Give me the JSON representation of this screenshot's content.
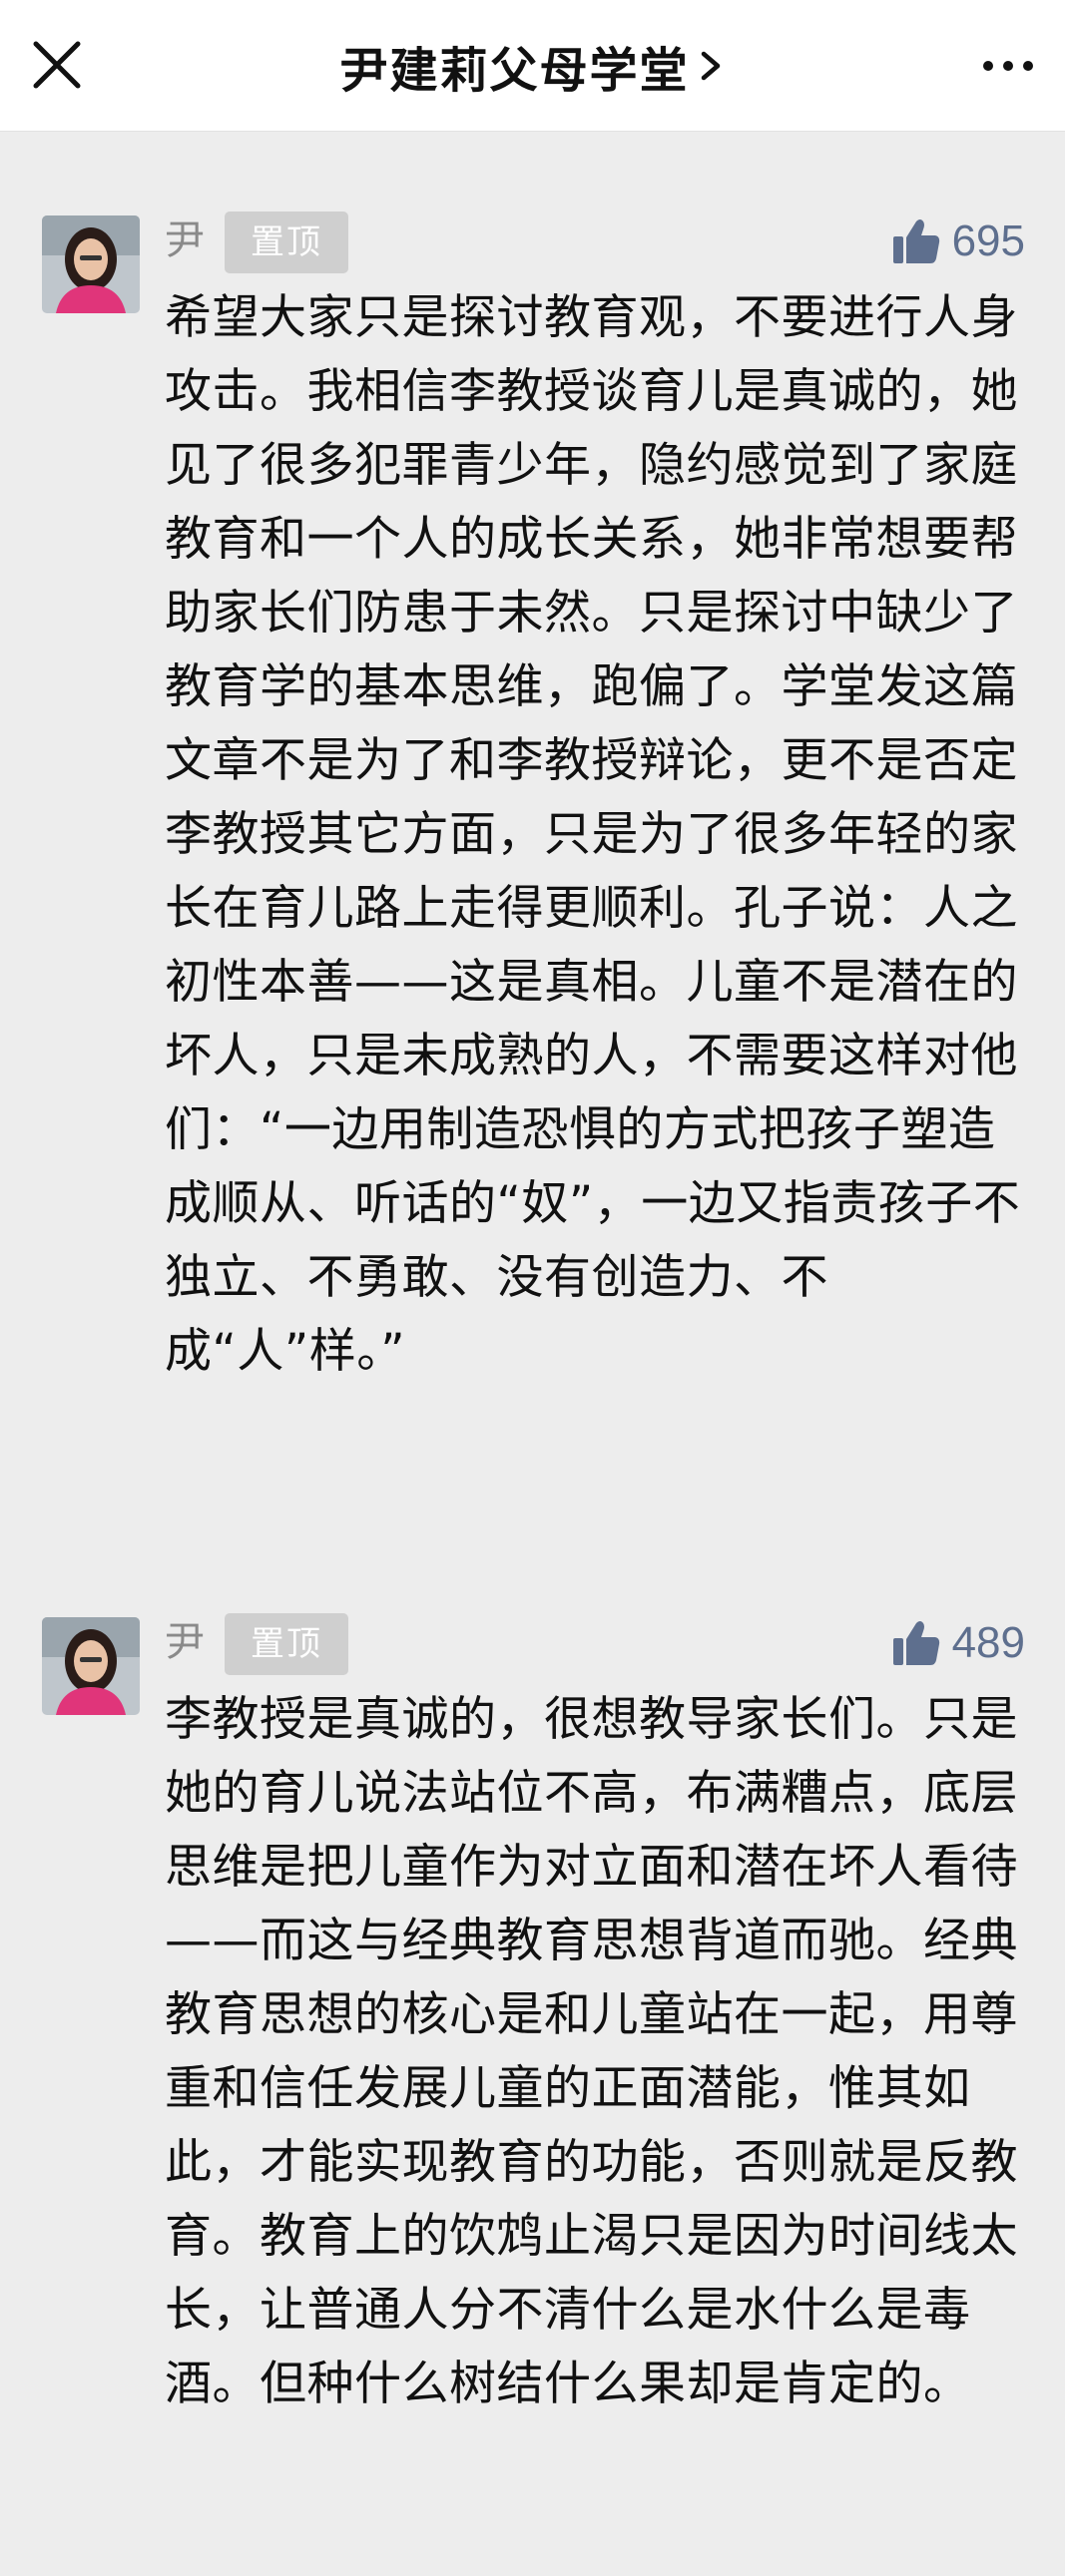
{
  "header": {
    "title": "尹建莉父母学堂",
    "close_icon": "close-icon",
    "chevron_icon": "chevron-right-icon",
    "more_icon": "more-icon"
  },
  "colors": {
    "accent": "#5e6f8e",
    "pin_badge": "#cfcfcf",
    "background": "#ededed"
  },
  "comments": [
    {
      "author": "尹",
      "badge": "置顶",
      "likes": "695",
      "text": "希望大家只是探讨教育观，不要进行人身攻击。我相信李教授谈育儿是真诚的，她见了很多犯罪青少年，隐约感觉到了家庭教育和一个人的成长关系，她非常想要帮助家长们防患于未然。只是探讨中缺少了教育学的基本思维，跑偏了。学堂发这篇文章不是为了和李教授辩论，更不是否定李教授其它方面，只是为了很多年轻的家长在育儿路上走得更顺利。孔子说：人之初性本善——这是真相。儿童不是潜在的坏人，只是未成熟的人，不需要这样对他们：“一边用制造恐惧的方式把孩子塑造成顺从、听话的“奴”，一边又指责孩子不独立、不勇敢、没有创造力、不成“人”样。”"
    },
    {
      "author": "尹",
      "badge": "置顶",
      "likes": "489",
      "text": "李教授是真诚的，很想教导家长们。只是她的育儿说法站位不高，布满糟点，底层思维是把儿童作为对立面和潜在坏人看待——而这与经典教育思想背道而驰。经典教育思想的核心是和儿童站在一起，用尊重和信任发展儿童的正面潜能，惟其如此，才能实现教育的功能，否则就是反教育。教育上的饮鸩止渴只是因为时间线太长，让普通人分不清什么是水什么是毒酒。但种什么树结什么果却是肯定的。"
    }
  ]
}
